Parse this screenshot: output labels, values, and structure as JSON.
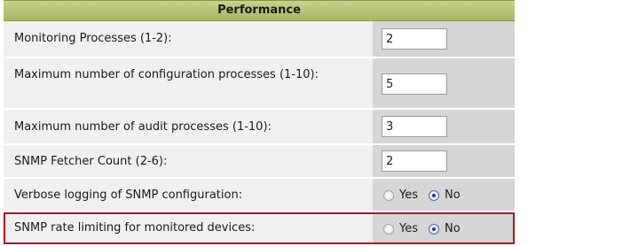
{
  "section": {
    "title": "Performance"
  },
  "rows": [
    {
      "label": "Monitoring Processes (1-2):",
      "value": "2"
    },
    {
      "label": "Maximum number of configuration processes (1-10):",
      "value": "5"
    },
    {
      "label": "Maximum number of audit processes (1-10):",
      "value": "3"
    },
    {
      "label": "SNMP Fetcher Count (2-6):",
      "value": "2"
    },
    {
      "label": "Verbose logging of SNMP configuration:",
      "options": [
        "Yes",
        "No"
      ],
      "selected": "No"
    },
    {
      "label": "SNMP rate limiting for monitored devices:",
      "options": [
        "Yes",
        "No"
      ],
      "selected": "No"
    }
  ],
  "colors": {
    "header": "#b3bd6c",
    "label_bg": "#f0f0f0",
    "value_bg": "#d6d6d6",
    "highlight": "#b0121c",
    "radio_selected": "#1e3f8a"
  }
}
